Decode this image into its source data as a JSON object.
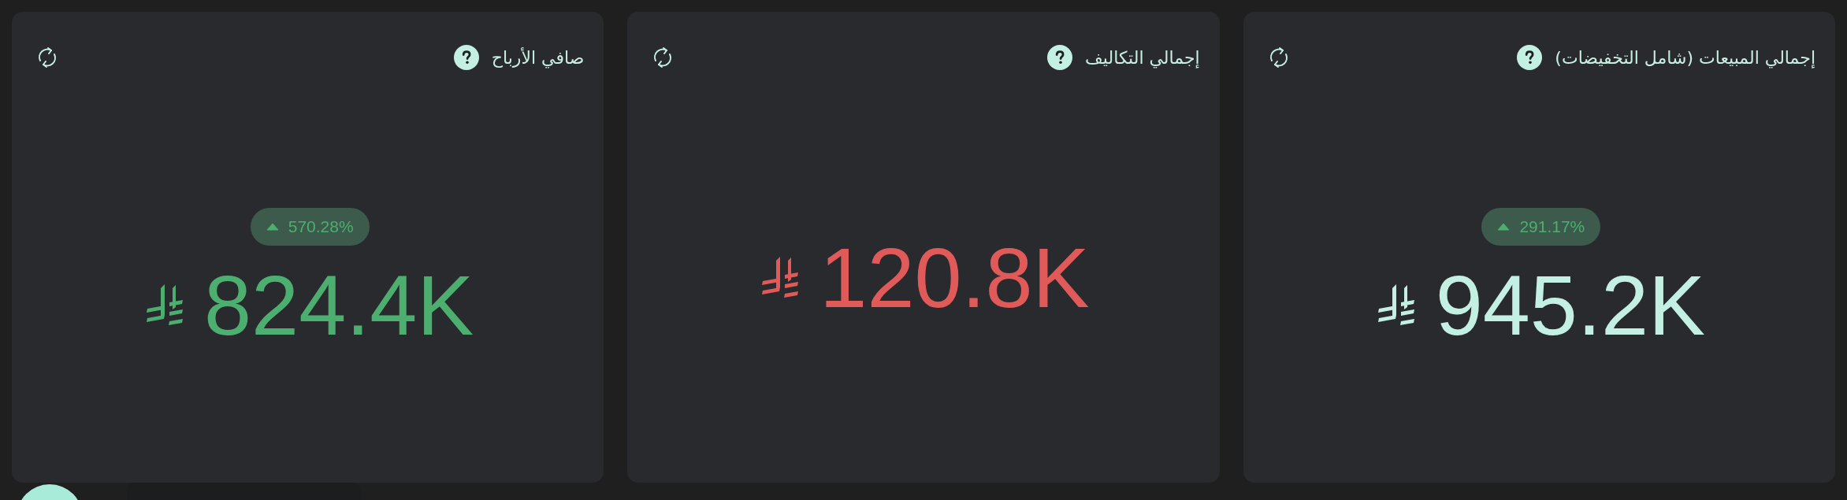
{
  "cards": [
    {
      "title": "إجمالي المبيعات (شامل التخفيضات)",
      "value": "945.2K",
      "color": "#c4f0e4",
      "trend": {
        "kind": "up",
        "text": "291.17%"
      }
    },
    {
      "title": "إجمالي التكاليف",
      "value": "120.8K",
      "color": "#e05a5a"
    },
    {
      "title": "صافي الأرباح",
      "value": "824.4K",
      "color": "#4caf70",
      "trend": {
        "kind": "up",
        "text": "570.28%"
      }
    }
  ]
}
